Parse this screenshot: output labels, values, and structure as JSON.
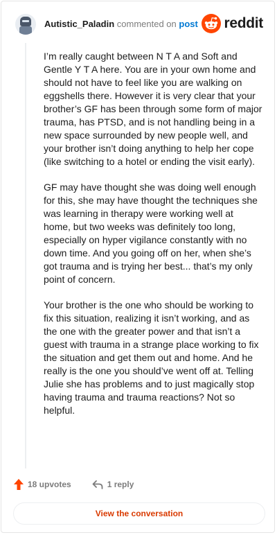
{
  "header": {
    "username": "Autistic_Paladin",
    "action_text": "commented on",
    "post_link": "post",
    "brand_word": "reddit",
    "avatar_icon": "paladin-avatar-icon",
    "brand_icon": "reddit-snoo-icon"
  },
  "comment": {
    "paragraphs": [
      "I’m really caught between N T A and Soft and Gentle Y T A here. You are in your own home and should not have to feel like you are walking on eggshells there. However it is very clear that your brother’s GF has been through some form of major trauma, has PTSD, and is not handling being in a new space surrounded by new people well, and your brother isn’t doing anything to help her cope (like switching to a hotel or ending the visit early).",
      "GF may have thought she was doing well enough for this, she may have thought the techniques she was learning in therapy were working well at home, but two weeks was definitely too long, especially on hyper vigilance constantly with no down time. And you going off on her, when she’s got trauma and is trying her best... that’s my only point of concern.",
      "Your brother is the one who should be working to fix this situation, realizing it isn’t working, and as the one with the greater power and that isn’t a guest with trauma in a strange place working to fix the situation and get them out and home. And he really is the one you should’ve went off at. Telling Julie she has problems and to just magically stop having trauma and trauma reactions? Not so helpful."
    ]
  },
  "actions": {
    "upvotes_label": "18 upvotes",
    "reply_label": "1 reply",
    "upvote_icon": "upvote-arrow-icon",
    "reply_icon": "reply-arrow-icon"
  },
  "footer": {
    "view_button_label": "View the conversation"
  },
  "colors": {
    "accent": "#d93a00",
    "link": "#0079d3",
    "upvote": "#ff4500",
    "muted": "#7c7c7c"
  }
}
